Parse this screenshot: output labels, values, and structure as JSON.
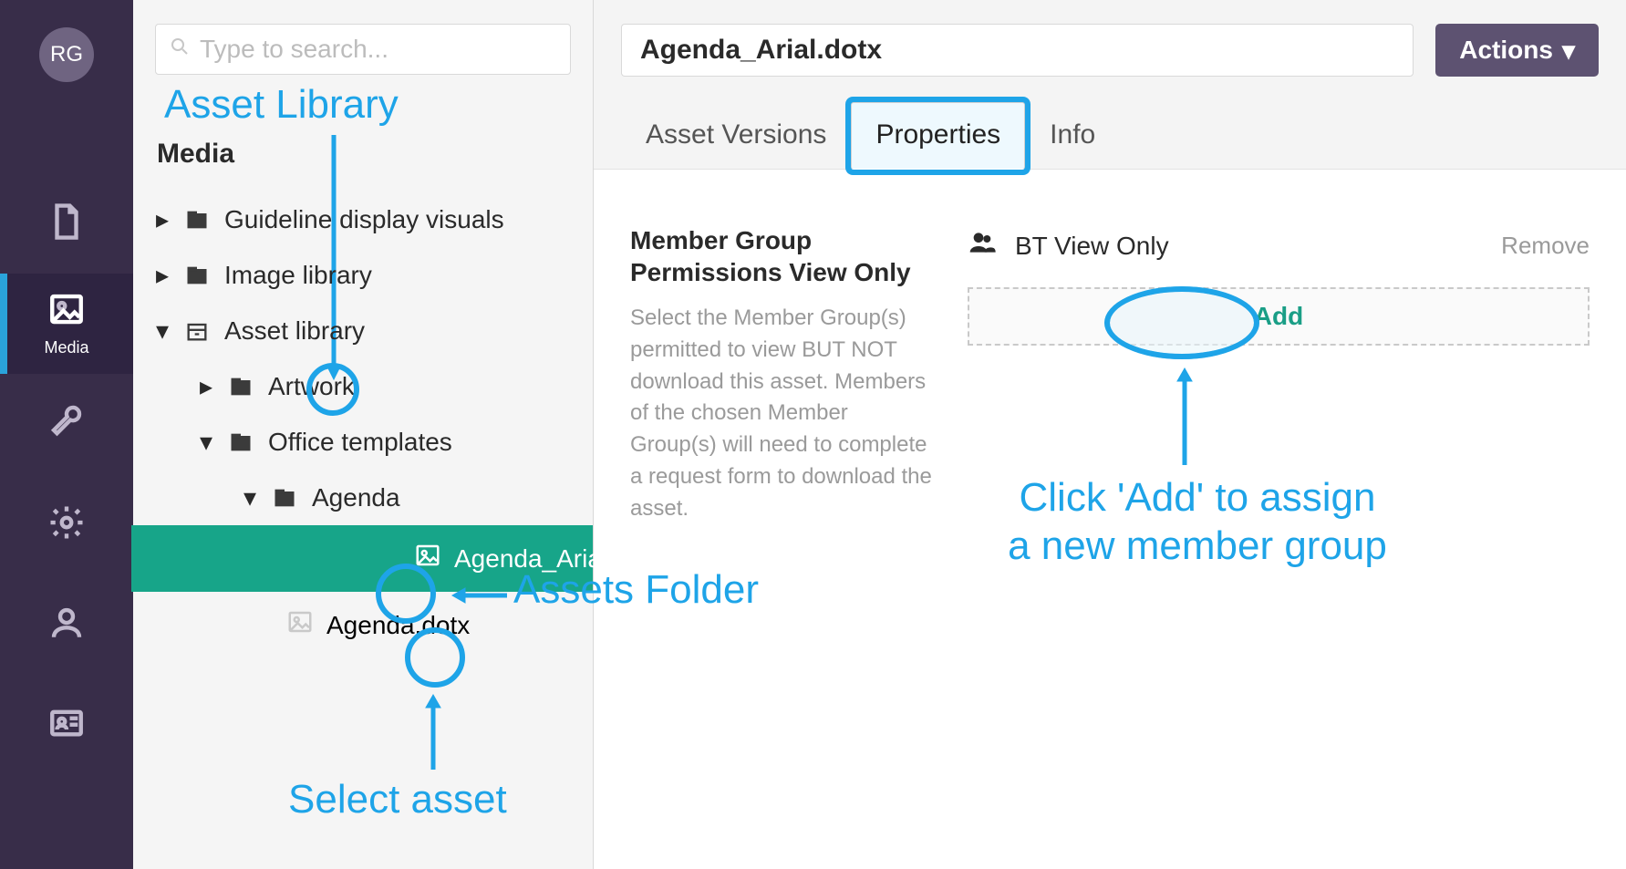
{
  "rail": {
    "avatar_initials": "RG",
    "media_label": "Media"
  },
  "search": {
    "placeholder": "Type to search..."
  },
  "tree": {
    "section_title": "Media",
    "items": [
      {
        "label": "Guideline display visuals"
      },
      {
        "label": "Image library"
      },
      {
        "label": "Asset library"
      },
      {
        "label": "Artwork"
      },
      {
        "label": "Office templates"
      },
      {
        "label": "Agenda"
      },
      {
        "label": "Agenda_Arial.dotx"
      },
      {
        "label": "Agenda.dotx"
      }
    ]
  },
  "header": {
    "title": "Agenda_Arial.dotx",
    "actions_label": "Actions"
  },
  "tabs": {
    "versions": "Asset Versions",
    "properties": "Properties",
    "info": "Info"
  },
  "properties": {
    "heading": "Member Group Permissions View Only",
    "description": "Select the Member Group(s) permitted to view BUT NOT download this asset. Members of the chosen Member Group(s) will need to complete a request form to download the asset.",
    "group_name": "BT View Only",
    "remove_label": "Remove",
    "add_label": "Add"
  },
  "annotations": {
    "asset_library": "Asset Library",
    "assets_folder": "Assets Folder",
    "select_asset": "Select asset",
    "add_callout_line1": "Click 'Add' to assign",
    "add_callout_line2": "a new member group"
  }
}
